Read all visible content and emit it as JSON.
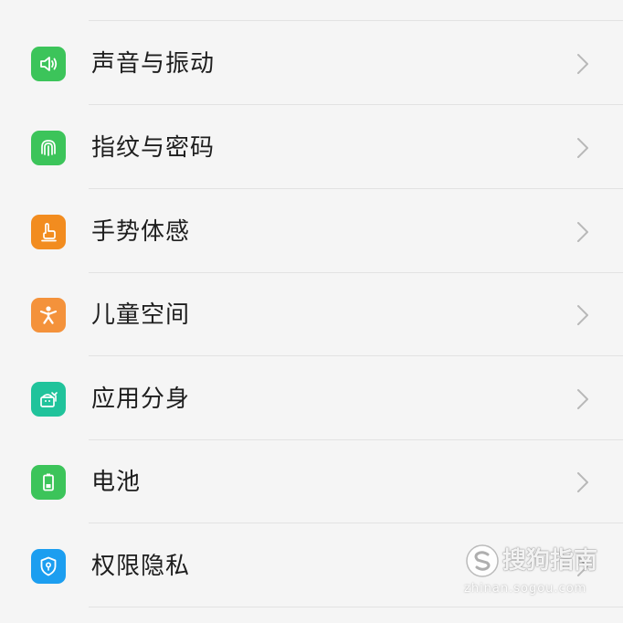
{
  "settings": {
    "items": [
      {
        "label": "声音与振动",
        "icon": "speaker-icon",
        "color": "#3cc45a"
      },
      {
        "label": "指纹与密码",
        "icon": "fingerprint-icon",
        "color": "#3cc45a"
      },
      {
        "label": "手势体感",
        "icon": "hand-gesture-icon",
        "color": "#f28c1f"
      },
      {
        "label": "儿童空间",
        "icon": "child-icon",
        "color": "#f4923b"
      },
      {
        "label": "应用分身",
        "icon": "app-clone-icon",
        "color": "#20c39b"
      },
      {
        "label": "电池",
        "icon": "battery-icon",
        "color": "#3cc45a"
      },
      {
        "label": "权限隐私",
        "icon": "shield-icon",
        "color": "#1c9ef0"
      }
    ],
    "chevron_icon": "chevron-right-icon"
  },
  "watermark": {
    "title": "搜狗指南",
    "url": "zhinan.sogou.com"
  }
}
